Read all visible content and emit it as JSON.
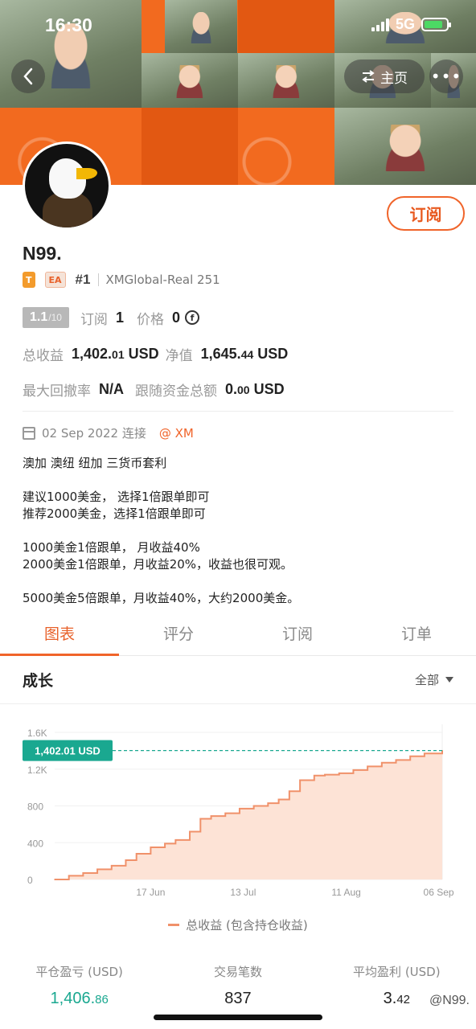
{
  "status_bar": {
    "time": "16:30",
    "network": "5G"
  },
  "nav": {
    "back_icon": "chevron-left-icon",
    "home_label": "主页",
    "home_icon": "swap-icon",
    "more_icon": "more-dots-icon"
  },
  "profile": {
    "name": "N99.",
    "subscribe_label": "订阅",
    "tag_t": "T",
    "tag_ea": "EA",
    "rank": "#1",
    "account": "XMGlobal-Real 251",
    "score": "1.1",
    "score_max": "/10",
    "subscriptions_label": "订阅",
    "subscriptions_value": "1",
    "price_label": "价格",
    "price_value": "0",
    "total_profit_label": "总收益",
    "total_profit_main": "1,402.",
    "total_profit_cents": "01",
    "total_profit_unit": " USD",
    "equity_label": "净值",
    "equity_main": "1,645.",
    "equity_cents": "44",
    "equity_unit": " USD",
    "max_drawdown_label": "最大回撤率",
    "max_drawdown_value": "N/A",
    "follow_funds_label": "跟随资金总额",
    "follow_funds_main": "0.",
    "follow_funds_cents": "00",
    "follow_funds_unit": " USD",
    "connected_date": "02 Sep 2022 连接",
    "broker": "@ XM",
    "description": [
      "澳加 澳纽 纽加 三货币套利",
      "",
      "建议1000美金， 选择1倍跟单即可",
      "推荐2000美金，选择1倍跟单即可",
      "",
      "1000美金1倍跟单， 月收益40%",
      "2000美金1倍跟单，月收益20%，收益也很可观。",
      "",
      "5000美金5倍跟单，月收益40%，大约2000美金。"
    ]
  },
  "tabs": [
    {
      "label": "图表",
      "active": true
    },
    {
      "label": "评分",
      "active": false
    },
    {
      "label": "订阅",
      "active": false
    },
    {
      "label": "订单",
      "active": false
    }
  ],
  "growth": {
    "title": "成长",
    "filter_label": "全部"
  },
  "chart_data": {
    "type": "area",
    "series": [
      {
        "name": "总收益 (包含持仓收益)",
        "x": [
          "2022-05-21",
          "2022-05-25",
          "2022-05-29",
          "2022-06-02",
          "2022-06-06",
          "2022-06-10",
          "2022-06-13",
          "2022-06-17",
          "2022-06-21",
          "2022-06-24",
          "2022-06-28",
          "2022-07-01",
          "2022-07-04",
          "2022-07-08",
          "2022-07-12",
          "2022-07-16",
          "2022-07-20",
          "2022-07-23",
          "2022-07-26",
          "2022-07-29",
          "2022-08-02",
          "2022-08-05",
          "2022-08-09",
          "2022-08-13",
          "2022-08-17",
          "2022-08-21",
          "2022-08-25",
          "2022-08-29",
          "2022-09-02",
          "2022-09-07"
        ],
        "values": [
          0,
          40,
          70,
          110,
          150,
          210,
          280,
          350,
          390,
          430,
          520,
          660,
          690,
          720,
          770,
          800,
          830,
          870,
          960,
          1080,
          1130,
          1140,
          1155,
          1190,
          1230,
          1270,
          1300,
          1340,
          1370,
          1402.01
        ]
      }
    ],
    "x_ticks": [
      "17 Jun",
      "13 Jul",
      "11 Aug",
      "06 Sep"
    ],
    "y_ticks": [
      "0",
      "400",
      "800",
      "1.2K",
      "1.6K"
    ],
    "ylim": [
      0,
      1600
    ],
    "current_value_label": "1,402.01 USD",
    "colors": {
      "line": "#f0916a",
      "fill": "#fde3d6",
      "marker": "#1aa890"
    }
  },
  "legend": {
    "label": "总收益 (包含持仓收益)"
  },
  "summary": [
    {
      "label": "平仓盈亏 (USD)",
      "main": "1,406.",
      "cents": "86",
      "color": "green"
    },
    {
      "label": "交易笔数",
      "main": "837",
      "cents": "",
      "color": "default"
    },
    {
      "label": "平均盈利 (USD)",
      "main": "3.",
      "cents": "42",
      "color": "default"
    }
  ],
  "watermark": "@N99.",
  "colors": {
    "accent": "#f0642a",
    "green": "#1aa890"
  }
}
